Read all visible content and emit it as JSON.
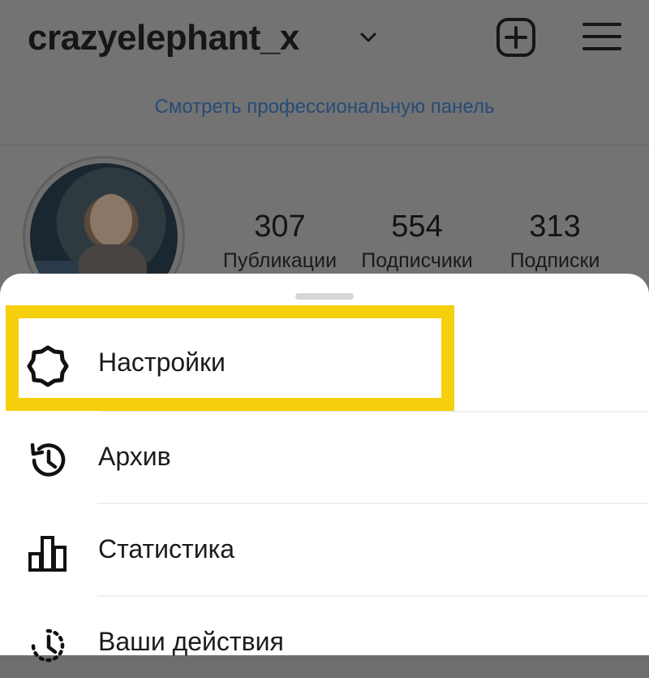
{
  "header": {
    "username": "crazyelephant_x"
  },
  "pro_dashboard_link": "Смотреть профессиональную панель",
  "stats": [
    {
      "value": "307",
      "label": "Публикации"
    },
    {
      "value": "554",
      "label": "Подписчики"
    },
    {
      "value": "313",
      "label": "Подписки"
    }
  ],
  "menu": {
    "items": [
      {
        "label": "Настройки",
        "icon": "settings-gear-icon"
      },
      {
        "label": "Архив",
        "icon": "archive-history-icon"
      },
      {
        "label": "Статистика",
        "icon": "insights-bar-chart-icon"
      },
      {
        "label": "Ваши действия",
        "icon": "your-activity-icon"
      }
    ],
    "highlight_color": "#f6cf0d"
  }
}
